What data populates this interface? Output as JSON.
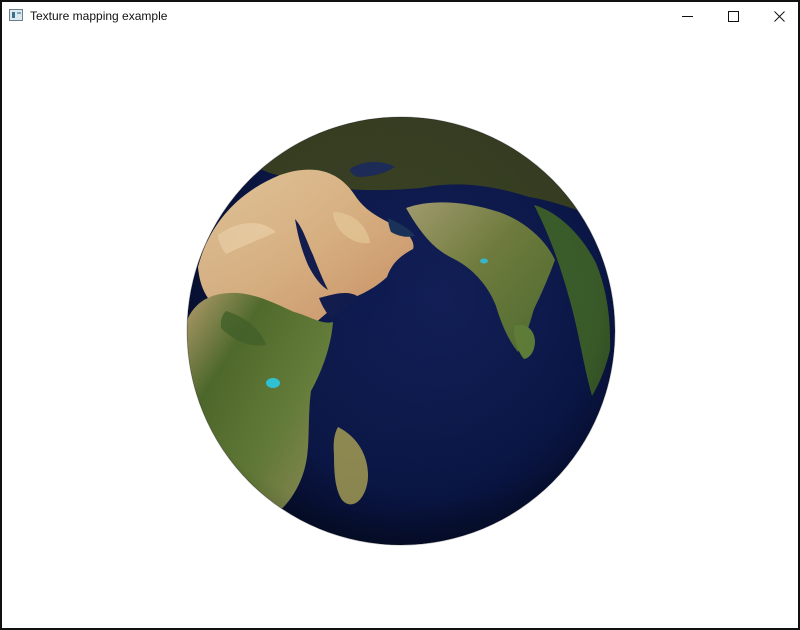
{
  "window": {
    "title": "Texture mapping example",
    "icons": {
      "app": "app-window-icon",
      "minimize": "minimize-icon",
      "maximize": "maximize-icon",
      "close": "close-icon"
    }
  },
  "scene": {
    "object": "textured-earth-sphere",
    "colors": {
      "ocean": "#0b1644",
      "deep_ocean": "#050a25",
      "land_green": "#47652b",
      "land_desert": "#d8bb8b",
      "ice_shadow": "#30341e"
    }
  }
}
